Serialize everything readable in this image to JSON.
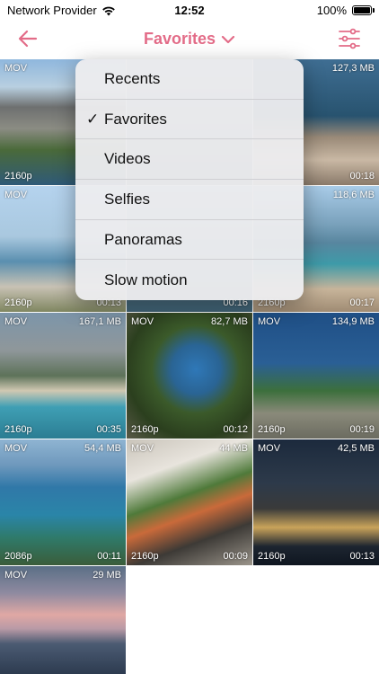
{
  "status_bar": {
    "carrier": "Network Provider",
    "time": "12:52",
    "battery": "100%"
  },
  "nav": {
    "title": "Favorites",
    "accent_color": "#e36c88"
  },
  "menu": {
    "items": [
      {
        "label": "Recents",
        "selected": false
      },
      {
        "label": "Favorites",
        "selected": true
      },
      {
        "label": "Videos",
        "selected": false
      },
      {
        "label": "Selfies",
        "selected": false
      },
      {
        "label": "Panoramas",
        "selected": false
      },
      {
        "label": "Slow motion",
        "selected": false
      }
    ],
    "check_glyph": "✓"
  },
  "videos": [
    {
      "type": "MOV",
      "size": "",
      "resolution": "2160p",
      "duration": ""
    },
    {
      "type": "",
      "size": "",
      "resolution": "",
      "duration": ""
    },
    {
      "type": "",
      "size": "127,3 MB",
      "resolution": "",
      "duration": "00:18"
    },
    {
      "type": "MOV",
      "size": "",
      "resolution": "2160p",
      "duration": "00:13"
    },
    {
      "type": "",
      "size": "",
      "resolution": "",
      "duration": "00:16"
    },
    {
      "type": "",
      "size": "118,6 MB",
      "resolution": "2160p",
      "duration": "00:17"
    },
    {
      "type": "MOV",
      "size": "167,1 MB",
      "resolution": "2160p",
      "duration": "00:35"
    },
    {
      "type": "MOV",
      "size": "82,7 MB",
      "resolution": "2160p",
      "duration": "00:12"
    },
    {
      "type": "MOV",
      "size": "134,9 MB",
      "resolution": "2160p",
      "duration": "00:19"
    },
    {
      "type": "MOV",
      "size": "54,4 MB",
      "resolution": "2086p",
      "duration": "00:11"
    },
    {
      "type": "MOV",
      "size": "44 MB",
      "resolution": "2160p",
      "duration": "00:09"
    },
    {
      "type": "MOV",
      "size": "42,5 MB",
      "resolution": "2160p",
      "duration": "00:13"
    },
    {
      "type": "MOV",
      "size": "29 MB",
      "resolution": "",
      "duration": ""
    }
  ]
}
